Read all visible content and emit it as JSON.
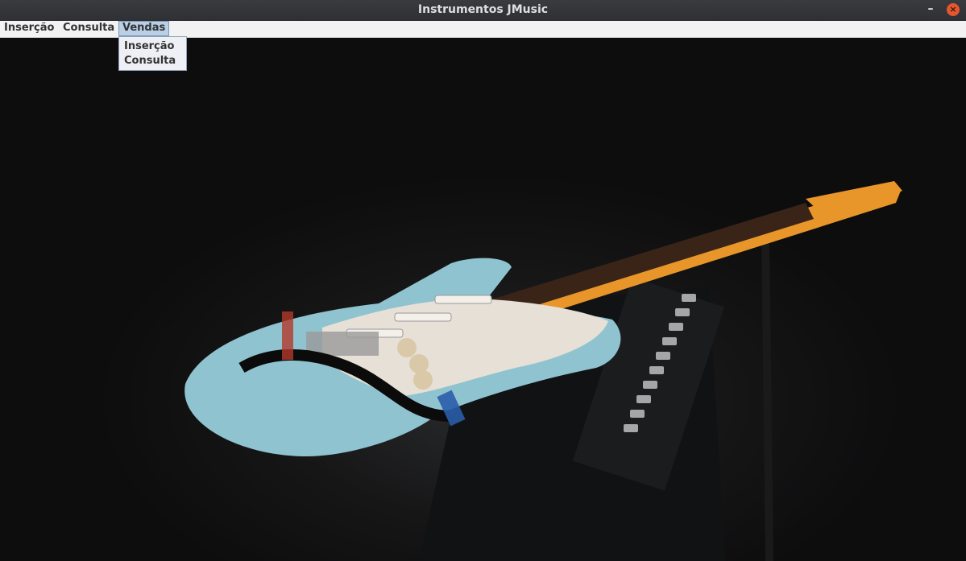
{
  "window": {
    "title": "Instrumentos JMusic",
    "minimize_glyph": "–",
    "close_glyph": "×"
  },
  "menubar": {
    "items": [
      {
        "label": "Inserção"
      },
      {
        "label": "Consulta"
      },
      {
        "label": "Vendas"
      }
    ]
  },
  "dropdown": {
    "items": [
      {
        "label": "Inserção"
      },
      {
        "label": "Consulta"
      }
    ]
  },
  "background": {
    "icon": "guitar-photo",
    "body_color": "#8fc3cf",
    "neck_color": "#e8962a",
    "pickguard_color": "#e6e0d6"
  }
}
